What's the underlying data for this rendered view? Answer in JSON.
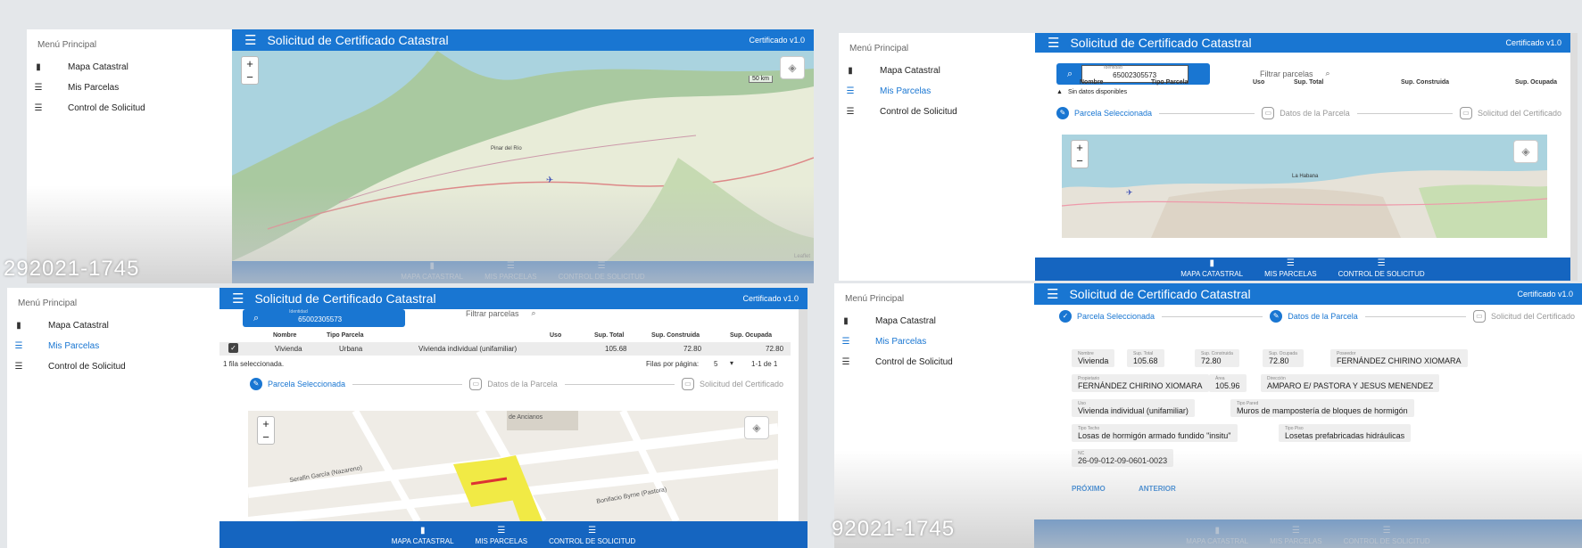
{
  "app": {
    "title": "Solicitud de Certificado Catastral",
    "version": "Certificado v1.0",
    "menu_title": "Menú Principal"
  },
  "menu": {
    "items": [
      {
        "label": "Mapa Catastral",
        "icon": "map-icon"
      },
      {
        "label": "Mis Parcelas",
        "icon": "list-icon"
      },
      {
        "label": "Control de Solicitud",
        "icon": "list-icon"
      }
    ]
  },
  "bottom_nav": {
    "items": [
      {
        "label": "MAPA CATASTRAL",
        "icon": "map-icon"
      },
      {
        "label": "MIS PARCELAS",
        "icon": "list-icon"
      },
      {
        "label": "CONTROL DE SOLICITUD",
        "icon": "list-icon"
      }
    ]
  },
  "watermark": {
    "left": "292021-1745",
    "right": "92021-1745"
  },
  "map": {
    "zoom_in": "+",
    "zoom_out": "−",
    "scale": "50 km",
    "attribution": "Leaflet",
    "places": [
      "Pinar del Río",
      "La Habana"
    ],
    "streets": [
      "Serafín García (Nazareno)",
      "Bonifacio Byrne (Pastora)",
      "de Ancianos"
    ]
  },
  "search": {
    "label": "Identidad",
    "value": "65002305573",
    "filter_placeholder": "Filtrar parcelas"
  },
  "table": {
    "headers": [
      "Nombre",
      "Tipo Parcela",
      "Uso",
      "Sup. Total",
      "Sup. Construida",
      "Sup. Ocupada"
    ],
    "empty_text": "Sin datos disponibles",
    "row": [
      "Vivienda",
      "Urbana",
      "Vivienda individual (unifamiliar)",
      "105.68",
      "72.80",
      "72.80"
    ],
    "selected_text": "1 fila seleccionada.",
    "rows_per_page_label": "Filas por página:",
    "rows_per_page_value": "5",
    "range": "1-1 de 1"
  },
  "stepper": {
    "steps": [
      "Parcela Seleccionada",
      "Datos de la Parcela",
      "Solicitud del Certificado"
    ]
  },
  "details": {
    "fields": [
      {
        "label": "Nombre",
        "value": "Vivienda"
      },
      {
        "label": "Sup. Total",
        "value": "105.68"
      },
      {
        "label": "Sup. Construida",
        "value": "72.80"
      },
      {
        "label": "Sup. Ocupada",
        "value": "72.80"
      },
      {
        "label": "Poseedor",
        "value": "FERNÁNDEZ CHIRINO XIOMARA"
      },
      {
        "label": "Propietario",
        "value": "FERNÁNDEZ CHIRINO XIOMARA"
      },
      {
        "label": "Área",
        "value": "105.96"
      },
      {
        "label": "Dirección",
        "value": "AMPARO E/ PASTORA Y JESUS MENENDEZ"
      },
      {
        "label": "Uso",
        "value": "Vivienda individual (unifamiliar)"
      },
      {
        "label": "Tipo Pared",
        "value": "Muros de mampostería de bloques de hormigón"
      },
      {
        "label": "Tipo Techo",
        "value": "Losas de hormigón armado fundido \"insitu\""
      },
      {
        "label": "Tipo Piso",
        "value": "Losetas prefabricadas hidráulicas"
      },
      {
        "label": "NC",
        "value": "26-09-012-09-0601-0023"
      }
    ],
    "next": "PRÓXIMO",
    "back": "ANTERIOR"
  }
}
